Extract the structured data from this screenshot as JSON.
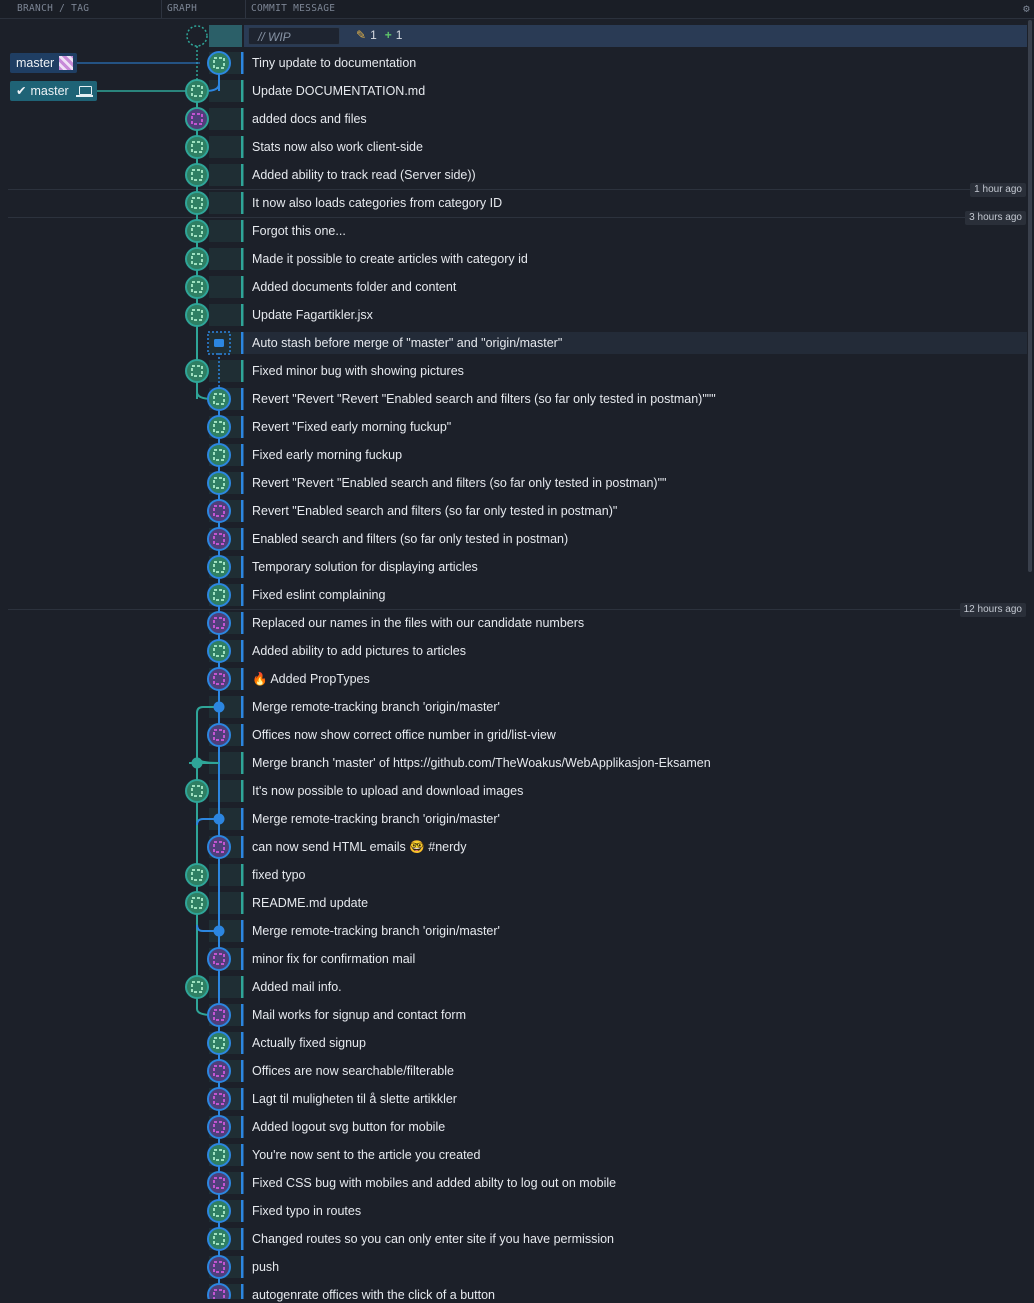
{
  "header": {
    "col_branch": "BRANCH / TAG",
    "col_graph": "GRAPH",
    "col_message": "COMMIT MESSAGE"
  },
  "wip": {
    "label": "// WIP",
    "modified_count": "1",
    "added_count": "1"
  },
  "refs": {
    "remote_label": "master",
    "local_label": "master"
  },
  "time_badges": [
    "1 hour ago",
    "3 hours ago",
    "12 hours ago"
  ],
  "colors": {
    "lane_teal": "#2fa598",
    "lane_blue": "#2c86e0",
    "avatar_green": "#44a37e",
    "avatar_purple": "#c155d1",
    "background": "#1c2029"
  },
  "commits": [
    {
      "message": "Tiny update to documentation",
      "lane": "right",
      "avatar": "green"
    },
    {
      "message": "Update DOCUMENTATION.md",
      "lane": "left",
      "avatar": "green"
    },
    {
      "message": "added docs and files",
      "lane": "left",
      "avatar": "purple"
    },
    {
      "message": "Stats now also work client-side",
      "lane": "left",
      "avatar": "green"
    },
    {
      "message": "Added ability to track read (Server side))",
      "lane": "left",
      "avatar": "green"
    },
    {
      "message": "It now also loads categories from category ID",
      "lane": "left",
      "avatar": "green"
    },
    {
      "message": "Forgot this one...",
      "lane": "left",
      "avatar": "green"
    },
    {
      "message": "Made it possible to create articles with category id",
      "lane": "left",
      "avatar": "green"
    },
    {
      "message": "Added documents folder and content",
      "lane": "left",
      "avatar": "green"
    },
    {
      "message": "Update Fagartikler.jsx",
      "lane": "left",
      "avatar": "green"
    },
    {
      "message": "Auto stash before merge of \"master\" and \"origin/master\"",
      "lane": "right",
      "avatar": "stash"
    },
    {
      "message": "Fixed minor bug with showing pictures",
      "lane": "left",
      "avatar": "green"
    },
    {
      "message": "Revert \"Revert \"Revert \"Enabled search and filters (so far only tested in postman)\"\"\"",
      "lane": "right",
      "avatar": "green"
    },
    {
      "message": "Revert \"Fixed early morning fuckup\"",
      "lane": "right",
      "avatar": "green"
    },
    {
      "message": "Fixed early morning fuckup",
      "lane": "right",
      "avatar": "green"
    },
    {
      "message": "Revert \"Revert \"Enabled search and filters (so far only tested in postman)\"\"",
      "lane": "right",
      "avatar": "green"
    },
    {
      "message": "Revert \"Enabled search and filters (so far only tested in postman)\"",
      "lane": "right",
      "avatar": "purple"
    },
    {
      "message": "Enabled search and filters (so far only tested in postman)",
      "lane": "right",
      "avatar": "purple"
    },
    {
      "message": "Temporary solution for displaying articles",
      "lane": "right",
      "avatar": "green"
    },
    {
      "message": "Fixed eslint complaining",
      "lane": "right",
      "avatar": "green"
    },
    {
      "message": "Replaced our names in the files with our candidate numbers",
      "lane": "right",
      "avatar": "purple"
    },
    {
      "message": "Added ability to add pictures to articles",
      "lane": "right",
      "avatar": "green"
    },
    {
      "message": "🔥 Added PropTypes",
      "lane": "right",
      "avatar": "purple"
    },
    {
      "message": "Merge remote-tracking branch 'origin/master'",
      "lane": "right",
      "avatar": "merge"
    },
    {
      "message": "Offices now show correct office number in grid/list-view",
      "lane": "right",
      "avatar": "purple"
    },
    {
      "message": "Merge branch 'master' of https://github.com/TheWoakus/WebApplikasjon-Eksamen",
      "lane": "left",
      "avatar": "merge-teal"
    },
    {
      "message": "It's now possible to upload and download images",
      "lane": "left",
      "avatar": "green"
    },
    {
      "message": "Merge remote-tracking branch 'origin/master'",
      "lane": "right",
      "avatar": "merge"
    },
    {
      "message": "can now send HTML emails 🤓 #nerdy",
      "lane": "right",
      "avatar": "purple"
    },
    {
      "message": "fixed typo",
      "lane": "left",
      "avatar": "green"
    },
    {
      "message": "README.md update",
      "lane": "left",
      "avatar": "green"
    },
    {
      "message": "Merge remote-tracking branch 'origin/master'",
      "lane": "right",
      "avatar": "merge"
    },
    {
      "message": "minor fix for confirmation mail",
      "lane": "right",
      "avatar": "purple"
    },
    {
      "message": "Added mail info.",
      "lane": "left",
      "avatar": "green"
    },
    {
      "message": "Mail works for signup and contact form",
      "lane": "right",
      "avatar": "purple"
    },
    {
      "message": "Actually fixed signup",
      "lane": "right",
      "avatar": "green"
    },
    {
      "message": "Offices are now searchable/filterable",
      "lane": "right",
      "avatar": "purple"
    },
    {
      "message": "Lagt til muligheten til å slette artikkler",
      "lane": "right",
      "avatar": "purple"
    },
    {
      "message": "Added logout svg button for mobile",
      "lane": "right",
      "avatar": "purple"
    },
    {
      "message": "You're now sent to the article you created",
      "lane": "right",
      "avatar": "green"
    },
    {
      "message": "Fixed CSS bug with mobiles and added abilty to log out on mobile",
      "lane": "right",
      "avatar": "purple"
    },
    {
      "message": "Fixed typo in routes",
      "lane": "right",
      "avatar": "green"
    },
    {
      "message": "Changed routes so you can only enter site if you have permission",
      "lane": "right",
      "avatar": "green"
    },
    {
      "message": "push",
      "lane": "right",
      "avatar": "purple"
    },
    {
      "message": "autogenrate offices with the click of a button",
      "lane": "right",
      "avatar": "purple"
    }
  ]
}
